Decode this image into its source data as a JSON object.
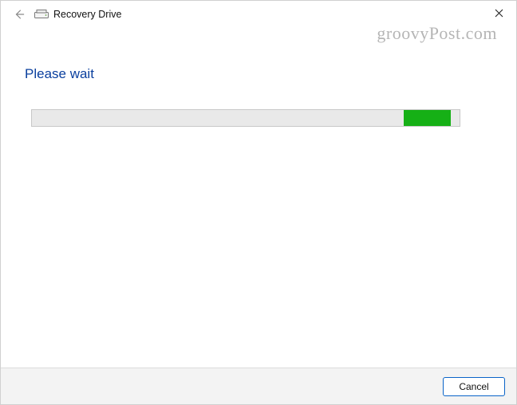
{
  "titlebar": {
    "title": "Recovery Drive",
    "back_icon": "back-arrow",
    "drive_icon": "drive",
    "close_icon": "close"
  },
  "watermark": "groovyPost.com",
  "content": {
    "heading": "Please wait",
    "progress": {
      "indeterminate": true,
      "fill_left_percent": 87,
      "fill_width_percent": 11,
      "fill_color": "#16b016",
      "track_color": "#e9e9e9"
    }
  },
  "footer": {
    "cancel_label": "Cancel"
  }
}
